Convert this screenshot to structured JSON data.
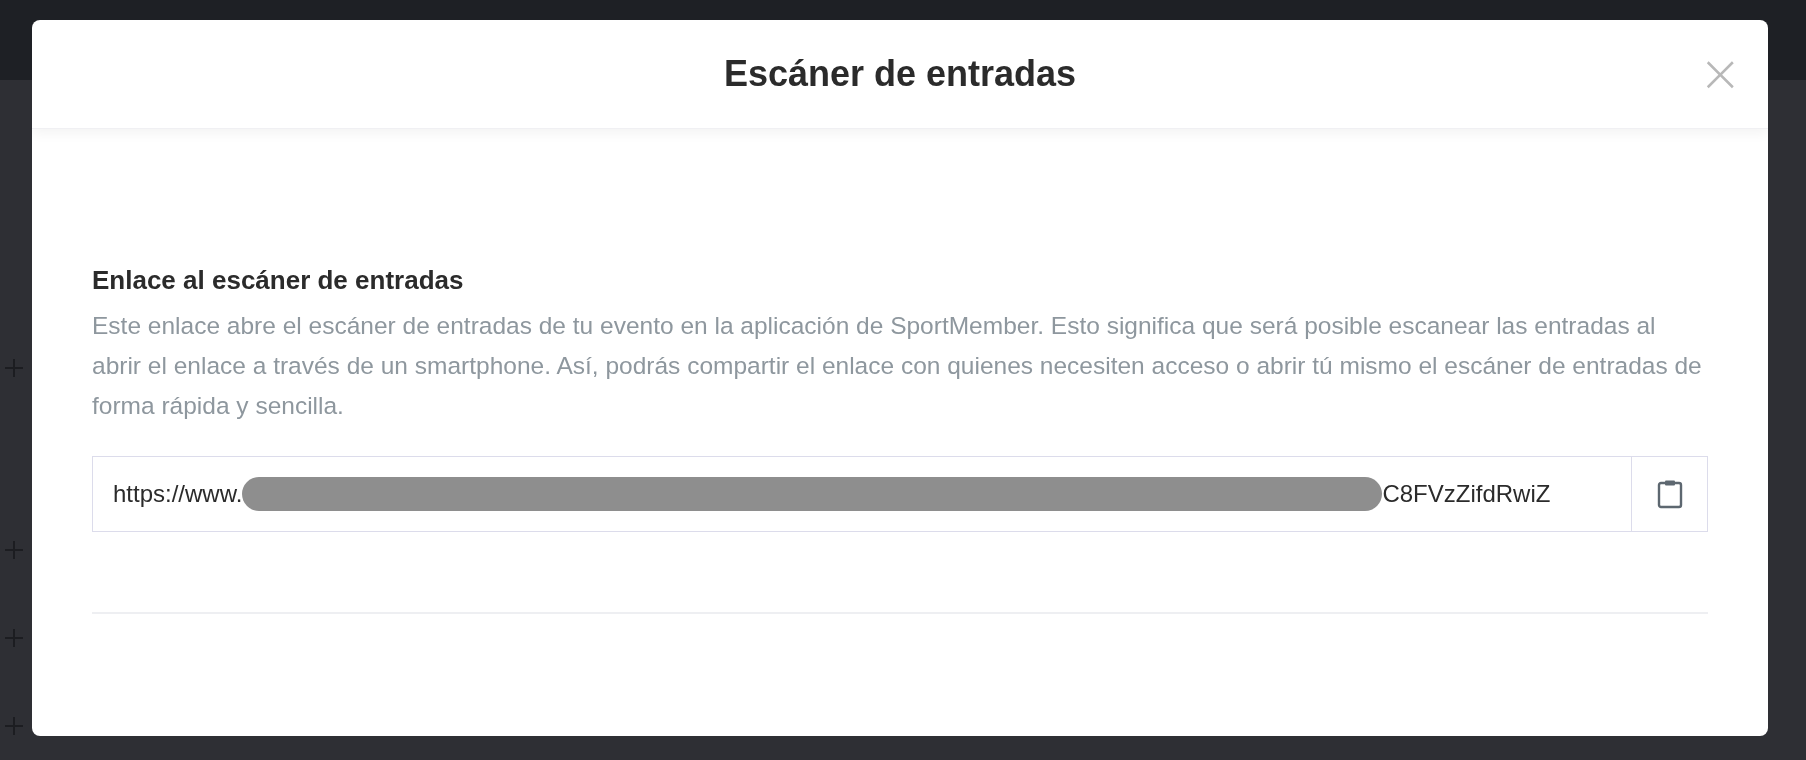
{
  "dialog": {
    "title": "Escáner de entradas",
    "close": "×",
    "section": {
      "heading": "Enlace al escáner de entradas",
      "description": "Este enlace abre el escáner de entradas de tu evento en la aplicación de SportMember. Esto significa que será posible escanear las entradas al abrir el enlace a través de un smartphone. Así, podrás compartir el enlace con quienes necesiten acceso o abrir tú mismo el escáner de entradas de forma rápida y sencilla.",
      "link_field": {
        "value_start": "https://www.",
        "redacted": true,
        "value_end": "C8FVzZifdRwiZ"
      }
    }
  }
}
